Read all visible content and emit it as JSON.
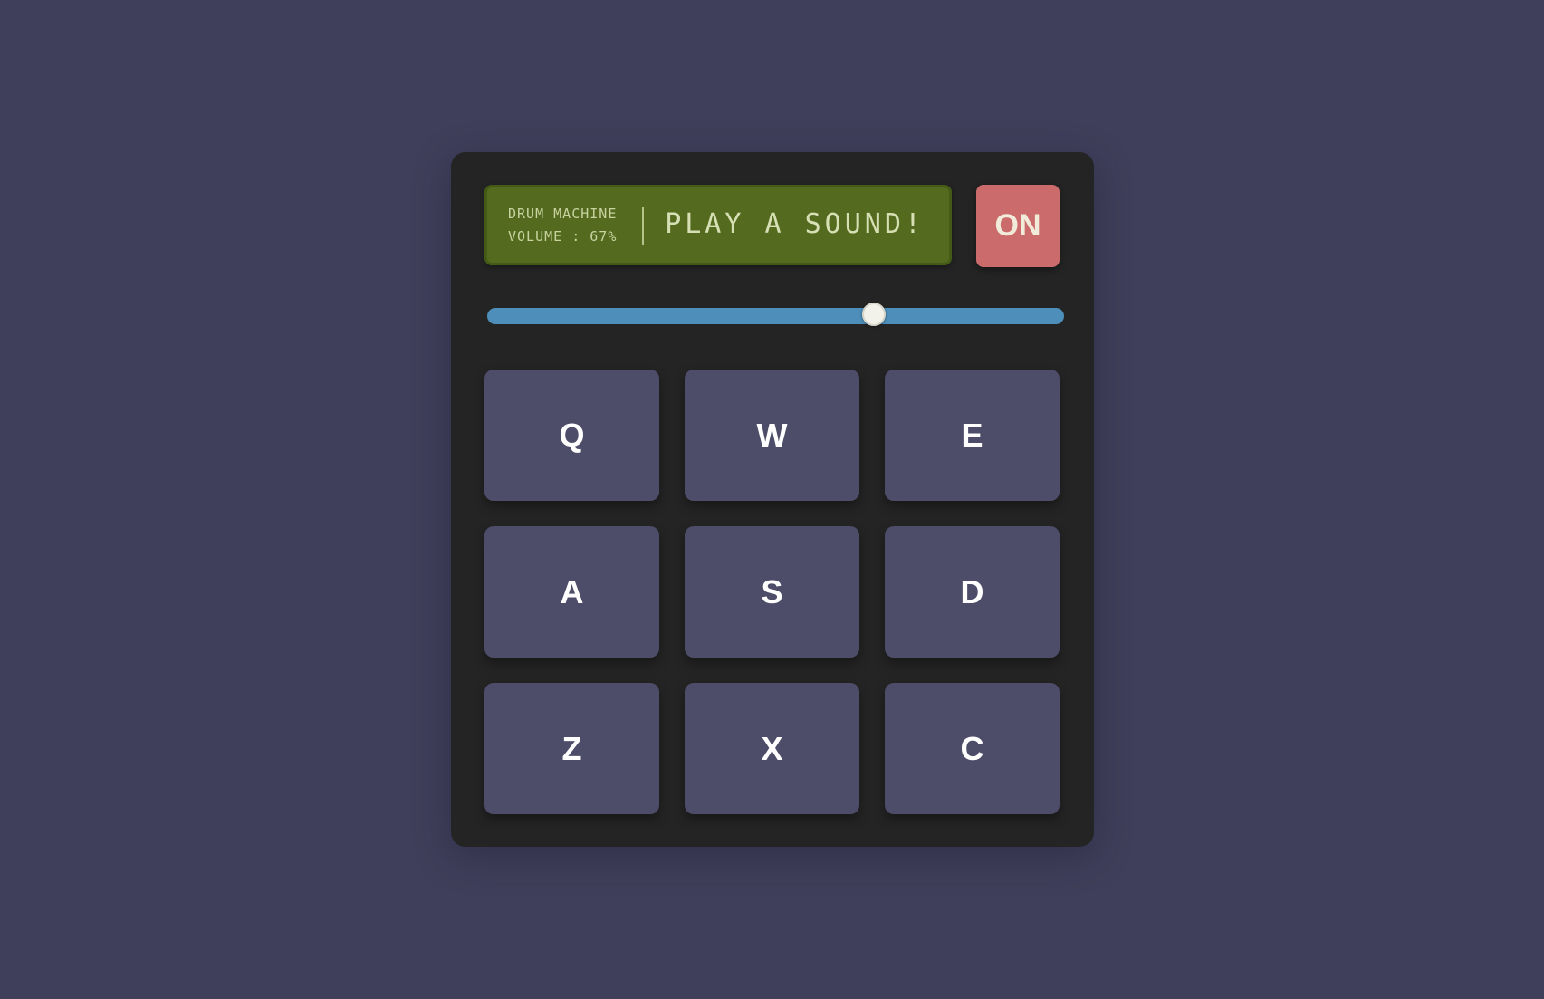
{
  "display": {
    "title": "DRUM MACHINE",
    "volume_label": "VOLUME : 67%",
    "message": "PLAY A SOUND!"
  },
  "power": {
    "label": "ON"
  },
  "volume": {
    "value": 67,
    "min": 0,
    "max": 100
  },
  "pads": [
    {
      "key": "Q"
    },
    {
      "key": "W"
    },
    {
      "key": "E"
    },
    {
      "key": "A"
    },
    {
      "key": "S"
    },
    {
      "key": "D"
    },
    {
      "key": "Z"
    },
    {
      "key": "X"
    },
    {
      "key": "C"
    }
  ],
  "colors": {
    "background": "#3f3f5b",
    "machine": "#242424",
    "display": "#546b1f",
    "power_on": "#cc6b6b",
    "slider": "#4d8fba",
    "pad": "#4d4d69"
  }
}
